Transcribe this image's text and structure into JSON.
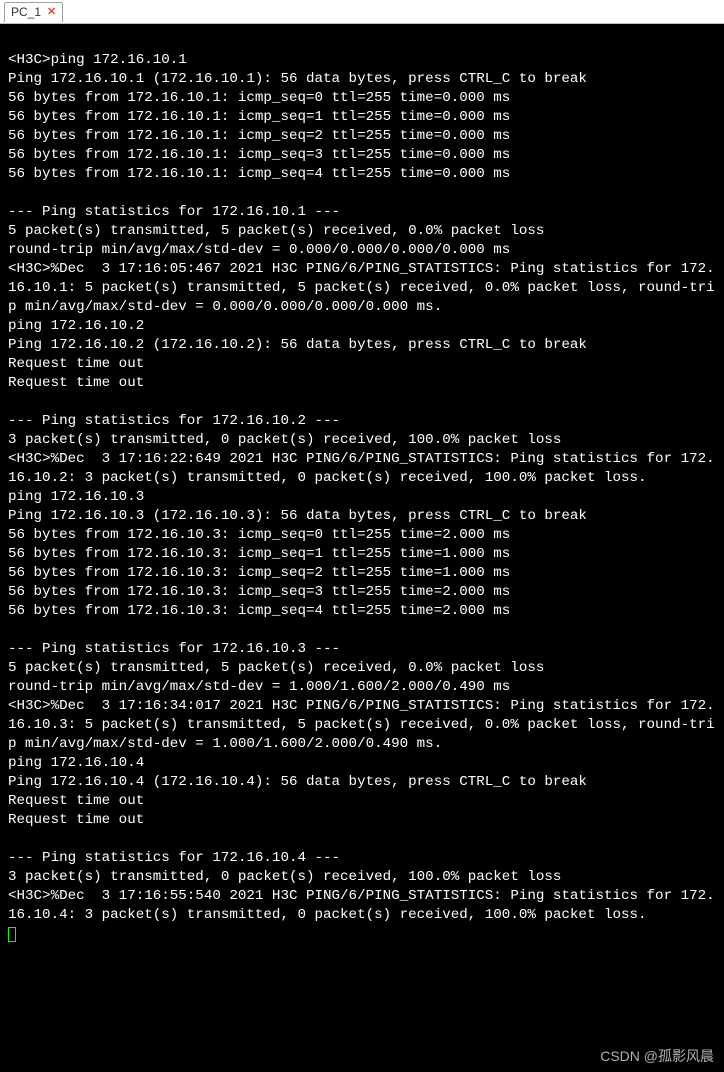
{
  "tab": {
    "label": "PC_1",
    "close_glyph": "✕"
  },
  "terminal": {
    "lines": [
      "",
      "<H3C>ping 172.16.10.1",
      "Ping 172.16.10.1 (172.16.10.1): 56 data bytes, press CTRL_C to break",
      "56 bytes from 172.16.10.1: icmp_seq=0 ttl=255 time=0.000 ms",
      "56 bytes from 172.16.10.1: icmp_seq=1 ttl=255 time=0.000 ms",
      "56 bytes from 172.16.10.1: icmp_seq=2 ttl=255 time=0.000 ms",
      "56 bytes from 172.16.10.1: icmp_seq=3 ttl=255 time=0.000 ms",
      "56 bytes from 172.16.10.1: icmp_seq=4 ttl=255 time=0.000 ms",
      "",
      "--- Ping statistics for 172.16.10.1 ---",
      "5 packet(s) transmitted, 5 packet(s) received, 0.0% packet loss",
      "round-trip min/avg/max/std-dev = 0.000/0.000/0.000/0.000 ms",
      "<H3C>%Dec  3 17:16:05:467 2021 H3C PING/6/PING_STATISTICS: Ping statistics for 172.16.10.1: 5 packet(s) transmitted, 5 packet(s) received, 0.0% packet loss, round-trip min/avg/max/std-dev = 0.000/0.000/0.000/0.000 ms.",
      "ping 172.16.10.2",
      "Ping 172.16.10.2 (172.16.10.2): 56 data bytes, press CTRL_C to break",
      "Request time out",
      "Request time out",
      "",
      "--- Ping statistics for 172.16.10.2 ---",
      "3 packet(s) transmitted, 0 packet(s) received, 100.0% packet loss",
      "<H3C>%Dec  3 17:16:22:649 2021 H3C PING/6/PING_STATISTICS: Ping statistics for 172.16.10.2: 3 packet(s) transmitted, 0 packet(s) received, 100.0% packet loss.",
      "ping 172.16.10.3",
      "Ping 172.16.10.3 (172.16.10.3): 56 data bytes, press CTRL_C to break",
      "56 bytes from 172.16.10.3: icmp_seq=0 ttl=255 time=2.000 ms",
      "56 bytes from 172.16.10.3: icmp_seq=1 ttl=255 time=1.000 ms",
      "56 bytes from 172.16.10.3: icmp_seq=2 ttl=255 time=1.000 ms",
      "56 bytes from 172.16.10.3: icmp_seq=3 ttl=255 time=2.000 ms",
      "56 bytes from 172.16.10.3: icmp_seq=4 ttl=255 time=2.000 ms",
      "",
      "--- Ping statistics for 172.16.10.3 ---",
      "5 packet(s) transmitted, 5 packet(s) received, 0.0% packet loss",
      "round-trip min/avg/max/std-dev = 1.000/1.600/2.000/0.490 ms",
      "<H3C>%Dec  3 17:16:34:017 2021 H3C PING/6/PING_STATISTICS: Ping statistics for 172.16.10.3: 5 packet(s) transmitted, 5 packet(s) received, 0.0% packet loss, round-trip min/avg/max/std-dev = 1.000/1.600/2.000/0.490 ms.",
      "ping 172.16.10.4",
      "Ping 172.16.10.4 (172.16.10.4): 56 data bytes, press CTRL_C to break",
      "Request time out",
      "Request time out",
      "",
      "--- Ping statistics for 172.16.10.4 ---",
      "3 packet(s) transmitted, 0 packet(s) received, 100.0% packet loss",
      "<H3C>%Dec  3 17:16:55:540 2021 H3C PING/6/PING_STATISTICS: Ping statistics for 172.16.10.4: 3 packet(s) transmitted, 0 packet(s) received, 100.0% packet loss."
    ]
  },
  "watermark": "CSDN @孤影风晨"
}
